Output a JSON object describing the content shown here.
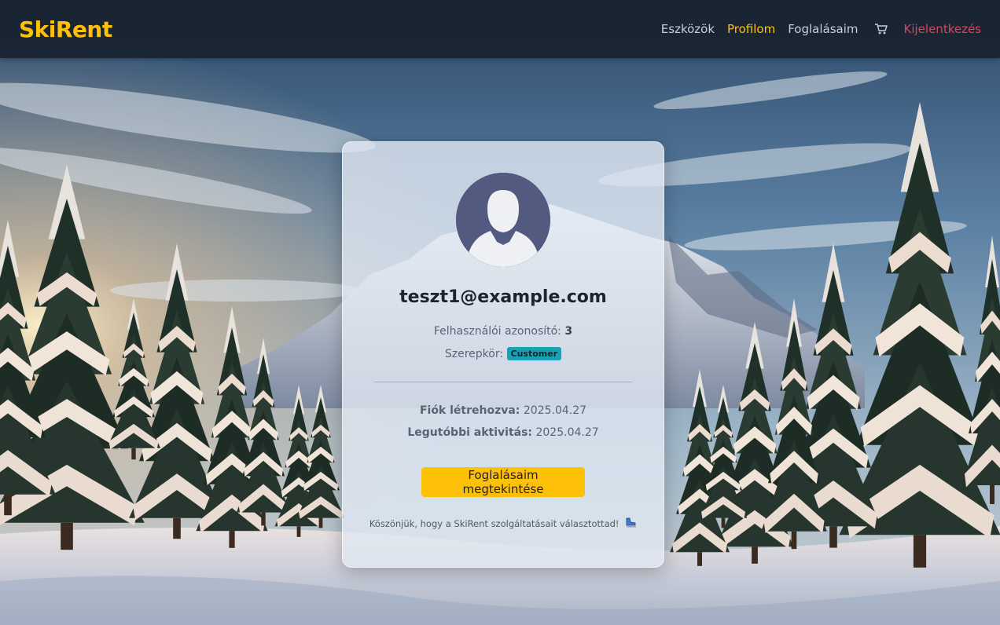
{
  "brand": {
    "name": "SkiRent",
    "color": "#ffc107"
  },
  "nav": {
    "items": [
      {
        "label": "Eszközök",
        "active": false
      },
      {
        "label": "Profilom",
        "active": true
      },
      {
        "label": "Foglalásaim",
        "active": false
      }
    ],
    "cart_icon": "cart-icon",
    "logout_label": "Kijelentkezés"
  },
  "profile": {
    "avatar_icon": "user-avatar-icon",
    "email": "teszt1@example.com",
    "user_id_label": "Felhasználói azonosító:",
    "user_id_value": "3",
    "role_label": "Szerepkör:",
    "role_value": "Customer",
    "created_label": "Fiók létrehozva:",
    "created_value": "2025.04.27",
    "last_activity_label": "Legutóbbi aktivitás:",
    "last_activity_value": "2025.04.27",
    "bookings_button_label": "Foglalásaim megtekintése",
    "thanks_text": "Köszönjük, hogy a SkiRent szolgáltatásait választottad!",
    "thanks_icon": "ice-skate-icon"
  },
  "colors": {
    "accent": "#ffc107",
    "logout": "#e0405e",
    "role_badge": "#17a2b8",
    "avatar_bg": "#525a80"
  }
}
